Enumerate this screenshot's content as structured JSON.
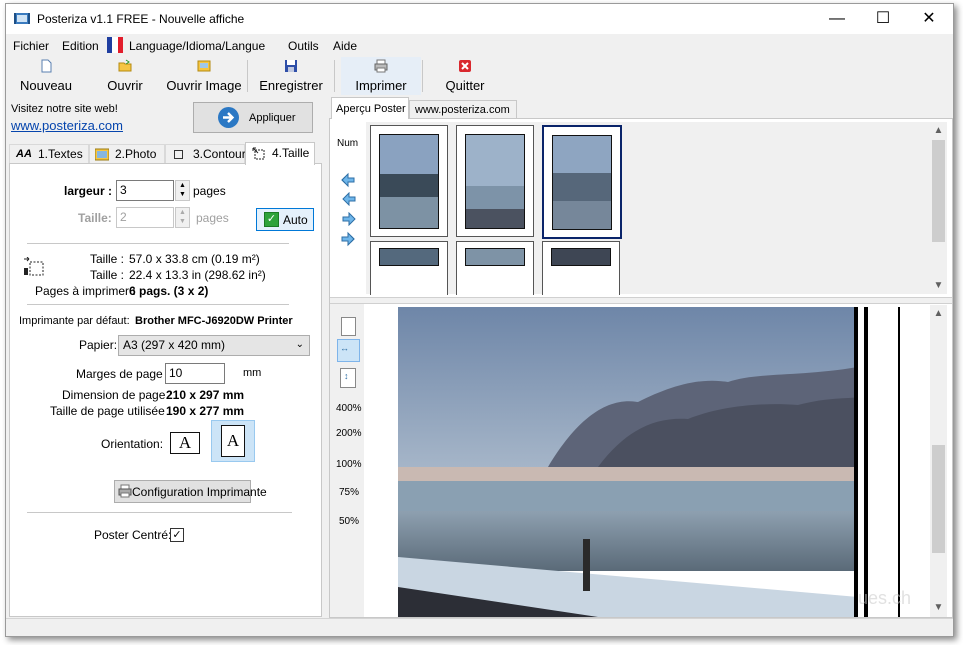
{
  "window": {
    "title": "Posteriza v1.1 FREE - Nouvelle affiche"
  },
  "menu": {
    "items": [
      "Fichier",
      "Edition",
      "Language/Idioma/Langue",
      "Outils",
      "Aide"
    ]
  },
  "toolbar": {
    "nouveau": "Nouveau",
    "ouvrir": "Ouvrir",
    "ouvrir_image": "Ouvrir Image",
    "enregistrer": "Enregistrer",
    "imprimer": "Imprimer",
    "quitter": "Quitter"
  },
  "left": {
    "visit_text": "Visitez notre site web!",
    "site_link": "www.posteriza.com",
    "apply_label": "Appliquer",
    "tabs": [
      "1.Textes",
      "2.Photo",
      "3.Contour",
      "4.Taille"
    ],
    "largeur_label": "largeur :",
    "largeur_value": "3",
    "pages_label": "pages",
    "taille_label": "Taille:",
    "taille_value": "2",
    "auto_label": "Auto",
    "taille_cm_label": "Taille :",
    "taille_cm_value": "57.0 x 33.8 cm (0.19 m²)",
    "taille_in_label": "Taille :",
    "taille_in_value": "22.4 x 13.3 in (298.62 in²)",
    "pages_imprimer_label": "Pages à imprimer :",
    "pages_imprimer_value": "6 pags. (3 x 2)",
    "imprimante_label": "Imprimante par défaut:",
    "imprimante_value": "Brother MFC-J6920DW Printer",
    "papier_label": "Papier:",
    "papier_value": "A3 (297 x 420 mm)",
    "marges_label": "Marges de page :",
    "marges_value": "10",
    "marges_unit": "mm",
    "dimension_label": "Dimension de page :",
    "dimension_value": "210 x 297 mm",
    "utilisee_label": "Taille de page utilisée :",
    "utilisee_value": "190 x 277 mm",
    "orientation_label": "Orientation:",
    "orientation_glyph": "A",
    "config_label": "Configuration Imprimante",
    "centre_label": "Poster Centré:"
  },
  "right": {
    "tabs": [
      "Aperçu Poster",
      "www.posteriza.com"
    ],
    "num_label": "Num",
    "zoom_levels": [
      "400%",
      "200%",
      "100%",
      "75%",
      "50%"
    ],
    "watermark": "ues.ch"
  },
  "colors": {
    "accent": "#0645ad",
    "selection": "#0a246a",
    "apply": "#2b78c4"
  }
}
